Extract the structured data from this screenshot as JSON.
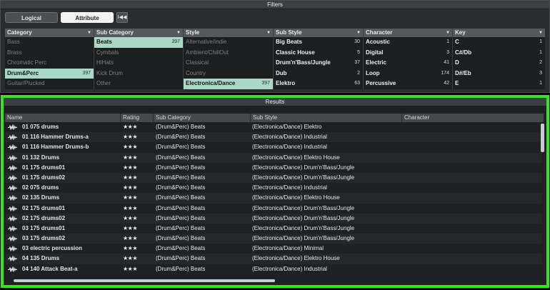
{
  "filters": {
    "title": "Filters",
    "mode_logical": "Logical",
    "mode_attribute": "Attribute",
    "reset_label": "I◀◀"
  },
  "columns": [
    {
      "header": "Category",
      "items": [
        {
          "label": "Bass",
          "count": "",
          "state": "dim"
        },
        {
          "label": "Brass",
          "count": "",
          "state": "dim"
        },
        {
          "label": "Chromatic Perc",
          "count": "",
          "state": "dim"
        },
        {
          "label": "Drum&Perc",
          "count": "397",
          "state": "selected"
        },
        {
          "label": "Guitar/Plucked",
          "count": "",
          "state": "dim"
        }
      ]
    },
    {
      "header": "Sub Category",
      "items": [
        {
          "label": "Beats",
          "count": "397",
          "state": "selected"
        },
        {
          "label": "Cymbals",
          "count": "",
          "state": "dim"
        },
        {
          "label": "HiHats",
          "count": "",
          "state": "dim"
        },
        {
          "label": "Kick Drum",
          "count": "",
          "state": "dim"
        },
        {
          "label": "Other",
          "count": "",
          "state": "dim"
        }
      ]
    },
    {
      "header": "Style",
      "items": [
        {
          "label": "Alternative/Indie",
          "count": "",
          "state": "dim"
        },
        {
          "label": "Ambient/ChillOut",
          "count": "",
          "state": "dim"
        },
        {
          "label": "Classical",
          "count": "",
          "state": "dim"
        },
        {
          "label": "Country",
          "count": "",
          "state": "dim"
        },
        {
          "label": "Electronica/Dance",
          "count": "397",
          "state": "selected"
        }
      ]
    },
    {
      "header": "Sub Style",
      "items": [
        {
          "label": "Big Beats",
          "count": "30",
          "state": "active"
        },
        {
          "label": "Classic House",
          "count": "5",
          "state": "active"
        },
        {
          "label": "Drum'n'Bass/Jungle",
          "count": "37",
          "state": "active"
        },
        {
          "label": "Dub",
          "count": "2",
          "state": "active"
        },
        {
          "label": "Elektro",
          "count": "63",
          "state": "active"
        }
      ]
    },
    {
      "header": "Character",
      "items": [
        {
          "label": "Acoustic",
          "count": "1",
          "state": "active"
        },
        {
          "label": "Digital",
          "count": "3",
          "state": "active"
        },
        {
          "label": "Electric",
          "count": "41",
          "state": "active"
        },
        {
          "label": "Loop",
          "count": "174",
          "state": "active"
        },
        {
          "label": "Percussive",
          "count": "42",
          "state": "active"
        }
      ]
    },
    {
      "header": "Key",
      "items": [
        {
          "label": "C",
          "count": "1",
          "state": "active"
        },
        {
          "label": "C#/Db",
          "count": "1",
          "state": "active"
        },
        {
          "label": "D",
          "count": "2",
          "state": "active"
        },
        {
          "label": "D#/Eb",
          "count": "3",
          "state": "active"
        },
        {
          "label": "E",
          "count": "1",
          "state": "active"
        }
      ]
    }
  ],
  "results": {
    "title": "Results",
    "highlight_color": "#33e61f",
    "headers": {
      "name": "Name",
      "rating": "Rating",
      "sub_category": "Sub Category",
      "sub_style": "Sub Style",
      "character": "Character"
    },
    "rows": [
      {
        "name": "01 075 drums",
        "rating": "★★★",
        "sub_category": "(Drum&Perc) Beats",
        "sub_style": "(Electronica/Dance) Elektro"
      },
      {
        "name": "01 116 Hammer Drums-a",
        "rating": "★★★",
        "sub_category": "(Drum&Perc) Beats",
        "sub_style": "(Electronica/Dance) Industrial"
      },
      {
        "name": "01 116 Hammer Drums-b",
        "rating": "★★★",
        "sub_category": "(Drum&Perc) Beats",
        "sub_style": "(Electronica/Dance) Industrial"
      },
      {
        "name": "01 132 Drums",
        "rating": "★★★",
        "sub_category": "(Drum&Perc) Beats",
        "sub_style": "(Electronica/Dance) Elektro House"
      },
      {
        "name": "01 175 drums01",
        "rating": "★★★",
        "sub_category": "(Drum&Perc) Beats",
        "sub_style": "(Electronica/Dance) Drum'n'Bass/Jungle"
      },
      {
        "name": "01 175 drums02",
        "rating": "★★★",
        "sub_category": "(Drum&Perc) Beats",
        "sub_style": "(Electronica/Dance) Drum'n'Bass/Jungle"
      },
      {
        "name": "02 075 drums",
        "rating": "★★★",
        "sub_category": "(Drum&Perc) Beats",
        "sub_style": "(Electronica/Dance) Industrial"
      },
      {
        "name": "02 135 Drums",
        "rating": "★★★",
        "sub_category": "(Drum&Perc) Beats",
        "sub_style": "(Electronica/Dance) Elektro House"
      },
      {
        "name": "02 175 drums01",
        "rating": "★★★",
        "sub_category": "(Drum&Perc) Beats",
        "sub_style": "(Electronica/Dance) Drum'n'Bass/Jungle"
      },
      {
        "name": "02 175 drums02",
        "rating": "★★★",
        "sub_category": "(Drum&Perc) Beats",
        "sub_style": "(Electronica/Dance) Drum'n'Bass/Jungle"
      },
      {
        "name": "03 175 drums01",
        "rating": "★★★",
        "sub_category": "(Drum&Perc) Beats",
        "sub_style": "(Electronica/Dance) Drum'n'Bass/Jungle"
      },
      {
        "name": "03 175 drums02",
        "rating": "★★★",
        "sub_category": "(Drum&Perc) Beats",
        "sub_style": "(Electronica/Dance) Drum'n'Bass/Jungle"
      },
      {
        "name": "03 electric percussion",
        "rating": "★★★",
        "sub_category": "(Drum&Perc) Beats",
        "sub_style": "(Electronica/Dance) Minimal"
      },
      {
        "name": "04 135 Drums",
        "rating": "★★★",
        "sub_category": "(Drum&Perc) Beats",
        "sub_style": "(Electronica/Dance) Elektro House"
      },
      {
        "name": "04 140 Attack Beat-a",
        "rating": "★★★",
        "sub_category": "(Drum&Perc) Beats",
        "sub_style": "(Electronica/Dance) Industrial"
      }
    ]
  }
}
